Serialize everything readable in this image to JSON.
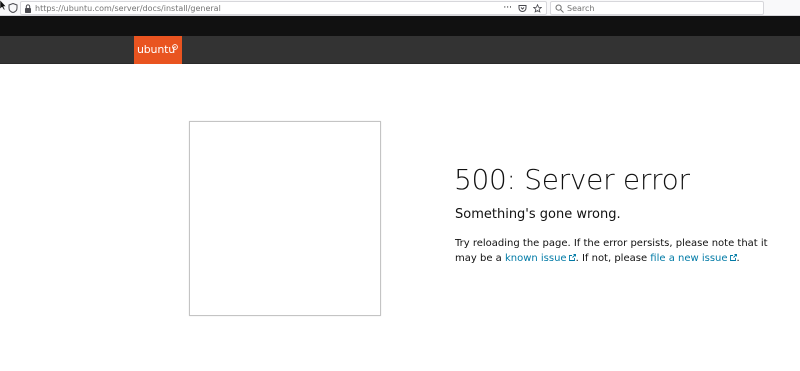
{
  "browser": {
    "url": "https://ubuntu.com/server/docs/install/general",
    "url_icons": [
      "···",
      "pocket-icon",
      "star-icon"
    ],
    "search_placeholder": "Search"
  },
  "header": {
    "logo_text": "ubuntu",
    "brand_color": "#e95420"
  },
  "error": {
    "title": "500: Server error",
    "subtitle": "Something's gone wrong.",
    "body_start": "Try reloading the page. If the error persists, please note that it may be a ",
    "link1": "known issue",
    "body_mid": ". If not, please ",
    "link2": "file a new issue",
    "body_end": "."
  }
}
